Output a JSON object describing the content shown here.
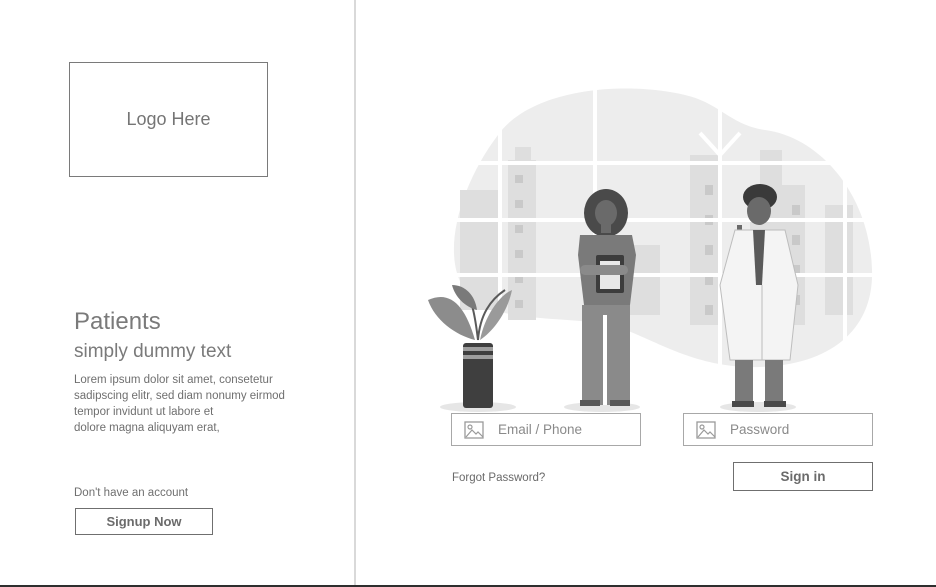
{
  "brand": {
    "logo_placeholder": "Logo Here"
  },
  "intro": {
    "title": "Patients",
    "subtitle": "simply dummy text",
    "description_lines": [
      "Lorem ipsum dolor sit amet, consetetur",
      "sadipscing elitr, sed diam nonumy eirmod",
      "tempor invidunt ut labore et",
      "dolore magna aliquyam erat,"
    ]
  },
  "signup": {
    "prompt": "Don't have an account",
    "button_label": "Signup Now"
  },
  "login": {
    "email_placeholder": "Email / Phone",
    "password_placeholder": "Password",
    "forgot_label": "Forgot Password?",
    "signin_label": "Sign in"
  },
  "icons": {
    "email_field_icon": "image-placeholder-icon",
    "password_field_icon": "image-placeholder-icon"
  },
  "colors": {
    "divider": "#d9d9d9",
    "border": "#6f6f6f",
    "text": "#6d6d6d"
  }
}
